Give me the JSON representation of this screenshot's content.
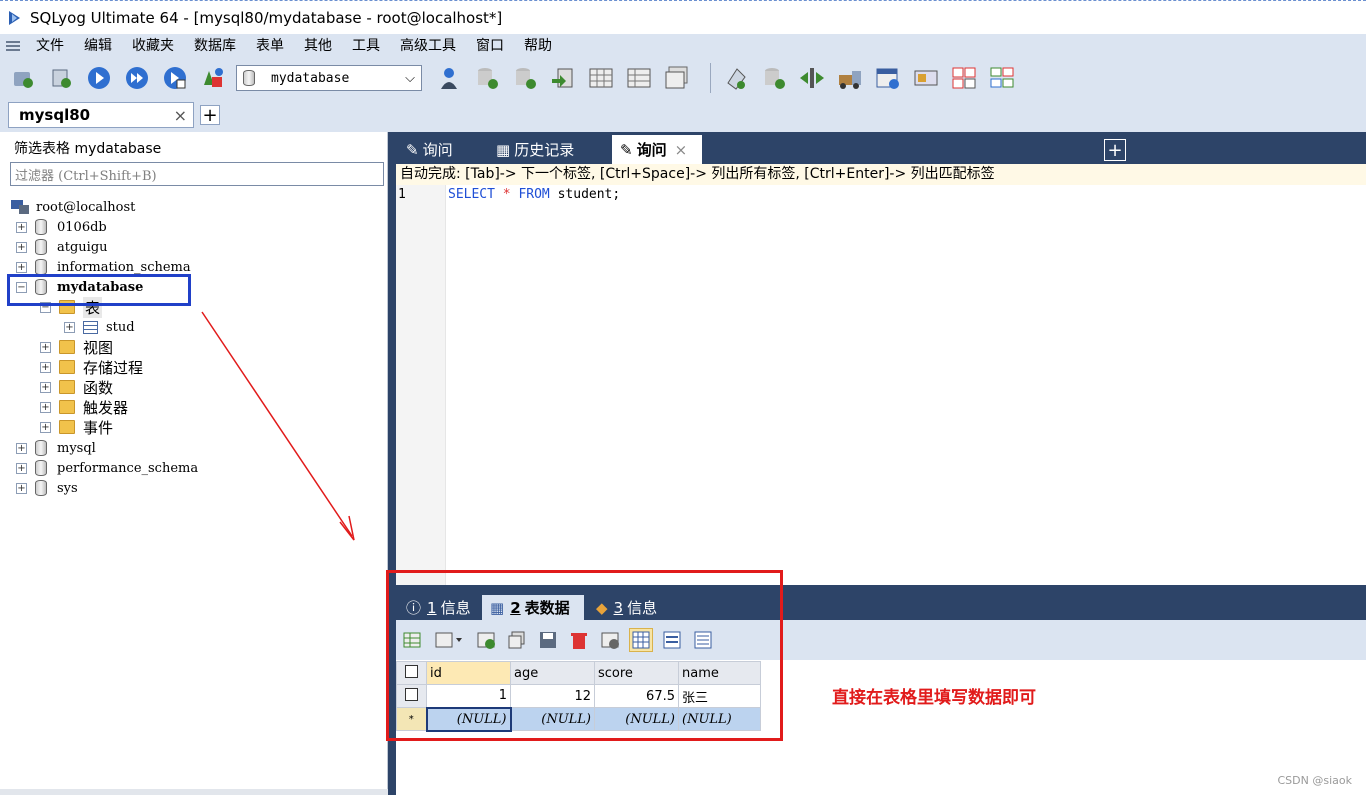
{
  "window": {
    "title": "SQLyog Ultimate 64 - [mysql80/mydatabase - root@localhost*]"
  },
  "menu": [
    "文件",
    "编辑",
    "收藏夹",
    "数据库",
    "表单",
    "其他",
    "工具",
    "高级工具",
    "窗口",
    "帮助"
  ],
  "toolbar": {
    "database_select": "mydatabase"
  },
  "connection_tab": {
    "label": "mysql80",
    "close": "×",
    "add": "+"
  },
  "left": {
    "filter_label": "筛选表格 mydatabase",
    "filter_placeholder": "过滤器 (Ctrl+Shift+B)",
    "root": "root@localhost",
    "dbs": [
      "0106db",
      "atguigu",
      "information_schema",
      "mydatabase",
      "mysql",
      "performance_schema",
      "sys"
    ],
    "folder_tables": "表",
    "table_stud": "stud",
    "folders": [
      "视图",
      "存储过程",
      "函数",
      "触发器",
      "事件"
    ]
  },
  "editor": {
    "tabs": [
      "询问",
      "历史记录",
      "询问"
    ],
    "close": "×",
    "add": "+",
    "autocomplete": "自动完成: [Tab]-> 下一个标签, [Ctrl+Space]-> 列出所有标签, [Ctrl+Enter]-> 列出匹配标签",
    "line": "1",
    "code": {
      "kw1": "SELECT",
      "star": "*",
      "kw2": "FROM",
      "rest": "student;"
    }
  },
  "results": {
    "tabs": [
      {
        "num": "1",
        "label": "信息"
      },
      {
        "num": "2",
        "label": "表数据"
      },
      {
        "num": "3",
        "label": "信息"
      }
    ],
    "columns": [
      "id",
      "age",
      "score",
      "name"
    ],
    "row1": {
      "marker": "",
      "id": "1",
      "age": "12",
      "score": "67.5",
      "name": "张三"
    },
    "new_row": {
      "marker": "*",
      "id": "(NULL)",
      "age": "(NULL)",
      "score": "(NULL)",
      "name": "(NULL)"
    }
  },
  "annotation": {
    "hint": "直接在表格里填写数据即可"
  },
  "watermark": "CSDN @siaok",
  "colors": {
    "annotation_red": "#e11b1b",
    "annotation_blue": "#2040c8",
    "panel_navy": "#2d4468",
    "toolbar_bg": "#dbe4f1"
  }
}
